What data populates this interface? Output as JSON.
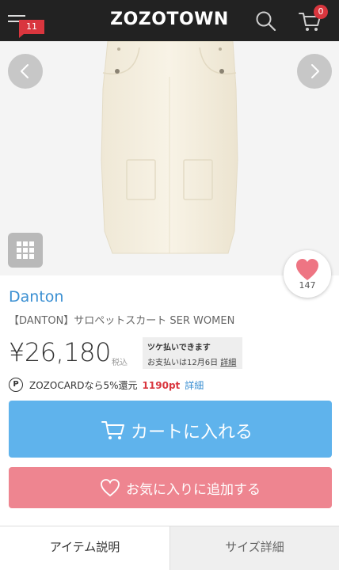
{
  "header": {
    "logo": "ZOZOTOWN",
    "menu_badge": "11",
    "cart_count": "0",
    "colors": {
      "background": "#222222",
      "badge": "#d9363e"
    }
  },
  "gallery": {
    "prev_icon": "chevron-left-icon",
    "next_icon": "chevron-right-icon",
    "grid_icon": "grid-icon",
    "favorite_count": "147"
  },
  "product": {
    "brand": "Danton",
    "name": "【DANTON】サロペットスカート SER WOMEN",
    "price": "¥26,180",
    "tax_label": "税込",
    "tsuke": {
      "title": "ツケ払いできます",
      "date_text": "お支払いは12月6日",
      "detail_link": "詳細"
    },
    "points": {
      "icon_letter": "P",
      "text": "ZOZOCARDなら5%還元",
      "value": "1190pt",
      "link": "詳細"
    }
  },
  "actions": {
    "cart_button": "カートに入れる",
    "favorite_button": "お気に入りに追加する",
    "colors": {
      "cart": "#5fb3ec",
      "favorite": "#ee8590",
      "brand_link": "#3a8fd2",
      "point_value": "#d9363e"
    }
  },
  "tabs": [
    {
      "label": "アイテム説明",
      "active": true
    },
    {
      "label": "サイズ詳細",
      "active": false
    }
  ]
}
